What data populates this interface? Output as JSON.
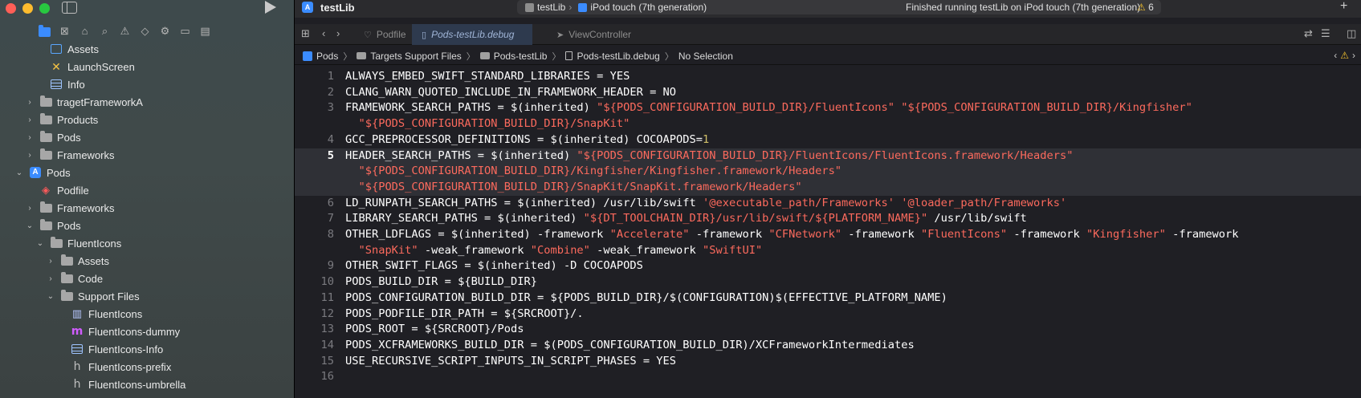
{
  "sidebar": {
    "tree": [
      {
        "label": "Assets",
        "indent": 2,
        "icon": "assets",
        "disclosure": ""
      },
      {
        "label": "LaunchScreen",
        "indent": 2,
        "icon": "launch",
        "disclosure": ""
      },
      {
        "label": "Info",
        "indent": 2,
        "icon": "table",
        "disclosure": ""
      },
      {
        "label": "tragetFrameworkA",
        "indent": 1,
        "icon": "folder",
        "disclosure": "›"
      },
      {
        "label": "Products",
        "indent": 1,
        "icon": "folder",
        "disclosure": "›"
      },
      {
        "label": "Pods",
        "indent": 1,
        "icon": "folder",
        "disclosure": "›"
      },
      {
        "label": "Frameworks",
        "indent": 1,
        "icon": "folder",
        "disclosure": "›"
      },
      {
        "label": "Pods",
        "indent": 0,
        "icon": "project",
        "disclosure": "⌄"
      },
      {
        "label": "Podfile",
        "indent": 1,
        "icon": "podfile",
        "disclosure": ""
      },
      {
        "label": "Frameworks",
        "indent": 1,
        "icon": "folder",
        "disclosure": "›"
      },
      {
        "label": "Pods",
        "indent": 1,
        "icon": "folder",
        "disclosure": "⌄"
      },
      {
        "label": "FluentIcons",
        "indent": 2,
        "icon": "folder",
        "disclosure": "⌄"
      },
      {
        "label": "Assets",
        "indent": 3,
        "icon": "folder",
        "disclosure": "›"
      },
      {
        "label": "Code",
        "indent": 3,
        "icon": "folder",
        "disclosure": "›"
      },
      {
        "label": "Support Files",
        "indent": 3,
        "icon": "folder",
        "disclosure": "⌄"
      },
      {
        "label": "FluentIcons",
        "indent": 4,
        "icon": "map",
        "disclosure": ""
      },
      {
        "label": "FluentIcons-dummy",
        "indent": 4,
        "icon": "m",
        "disclosure": ""
      },
      {
        "label": "FluentIcons-Info",
        "indent": 4,
        "icon": "table",
        "disclosure": ""
      },
      {
        "label": "FluentIcons-prefix",
        "indent": 4,
        "icon": "h",
        "disclosure": ""
      },
      {
        "label": "FluentIcons-umbrella",
        "indent": 4,
        "icon": "h",
        "disclosure": ""
      }
    ]
  },
  "window": {
    "title": "testLib",
    "scheme": "testLib",
    "device": "iPod touch (7th generation)",
    "status": "Finished running testLib on iPod touch (7th generation)",
    "warning_count": "6"
  },
  "tabs": [
    {
      "label": "Podfile",
      "active": false
    },
    {
      "label": "Pods-testLib.debug",
      "active": true
    },
    {
      "label": "ViewController",
      "active": false
    }
  ],
  "breadcrumb": [
    "Pods",
    "Targets Support Files",
    "Pods-testLib",
    "Pods-testLib.debug",
    "No Selection"
  ],
  "code": {
    "highlighted_line": 5,
    "lines": [
      {
        "n": "1",
        "rows": [
          [
            [
              "p",
              "ALWAYS_EMBED_SWIFT_STANDARD_LIBRARIES = YES"
            ]
          ]
        ]
      },
      {
        "n": "2",
        "rows": [
          [
            [
              "p",
              "CLANG_WARN_QUOTED_INCLUDE_IN_FRAMEWORK_HEADER = NO"
            ]
          ]
        ]
      },
      {
        "n": "3",
        "rows": [
          [
            [
              "p",
              "FRAMEWORK_SEARCH_PATHS = $(inherited) "
            ],
            [
              "s",
              "\"${PODS_CONFIGURATION_BUILD_DIR}/FluentIcons\""
            ],
            [
              "p",
              " "
            ],
            [
              "s",
              "\"${PODS_CONFIGURATION_BUILD_DIR}/Kingfisher\""
            ]
          ],
          [
            [
              "p",
              "  "
            ],
            [
              "s",
              "\"${PODS_CONFIGURATION_BUILD_DIR}/SnapKit\""
            ]
          ]
        ]
      },
      {
        "n": "4",
        "rows": [
          [
            [
              "p",
              "GCC_PREPROCESSOR_DEFINITIONS = $(inherited) COCOAPODS="
            ],
            [
              "n",
              "1"
            ]
          ]
        ]
      },
      {
        "n": "5",
        "rows": [
          [
            [
              "p",
              "HEADER_SEARCH_PATHS = $(inherited) "
            ],
            [
              "s",
              "\"${PODS_CONFIGURATION_BUILD_DIR}/FluentIcons/FluentIcons.framework/Headers\""
            ]
          ],
          [
            [
              "p",
              "  "
            ],
            [
              "s",
              "\"${PODS_CONFIGURATION_BUILD_DIR}/Kingfisher/Kingfisher.framework/Headers\""
            ]
          ],
          [
            [
              "p",
              "  "
            ],
            [
              "s",
              "\"${PODS_CONFIGURATION_BUILD_DIR}/SnapKit/SnapKit.framework/Headers\""
            ]
          ]
        ]
      },
      {
        "n": "6",
        "rows": [
          [
            [
              "p",
              "LD_RUNPATH_SEARCH_PATHS = $(inherited) /usr/lib/swift "
            ],
            [
              "s",
              "'@executable_path/Frameworks'"
            ],
            [
              "p",
              " "
            ],
            [
              "s",
              "'@loader_path/Frameworks'"
            ]
          ]
        ]
      },
      {
        "n": "7",
        "rows": [
          [
            [
              "p",
              "LIBRARY_SEARCH_PATHS = $(inherited) "
            ],
            [
              "s",
              "\"${DT_TOOLCHAIN_DIR}/usr/lib/swift/${PLATFORM_NAME}\""
            ],
            [
              "p",
              " /usr/lib/swift"
            ]
          ]
        ]
      },
      {
        "n": "8",
        "rows": [
          [
            [
              "p",
              "OTHER_LDFLAGS = $(inherited) -framework "
            ],
            [
              "s",
              "\"Accelerate\""
            ],
            [
              "p",
              " -framework "
            ],
            [
              "s",
              "\"CFNetwork\""
            ],
            [
              "p",
              " -framework "
            ],
            [
              "s",
              "\"FluentIcons\""
            ],
            [
              "p",
              " -framework "
            ],
            [
              "s",
              "\"Kingfisher\""
            ],
            [
              "p",
              " -framework"
            ]
          ],
          [
            [
              "p",
              "  "
            ],
            [
              "s",
              "\"SnapKit\""
            ],
            [
              "p",
              " -weak_framework "
            ],
            [
              "s",
              "\"Combine\""
            ],
            [
              "p",
              " -weak_framework "
            ],
            [
              "s",
              "\"SwiftUI\""
            ]
          ]
        ]
      },
      {
        "n": "9",
        "rows": [
          [
            [
              "p",
              "OTHER_SWIFT_FLAGS = $(inherited) -D COCOAPODS"
            ]
          ]
        ]
      },
      {
        "n": "10",
        "rows": [
          [
            [
              "p",
              "PODS_BUILD_DIR = ${BUILD_DIR}"
            ]
          ]
        ]
      },
      {
        "n": "11",
        "rows": [
          [
            [
              "p",
              "PODS_CONFIGURATION_BUILD_DIR = ${PODS_BUILD_DIR}/$(CONFIGURATION)$(EFFECTIVE_PLATFORM_NAME)"
            ]
          ]
        ]
      },
      {
        "n": "12",
        "rows": [
          [
            [
              "p",
              "PODS_PODFILE_DIR_PATH = ${SRCROOT}/."
            ]
          ]
        ]
      },
      {
        "n": "13",
        "rows": [
          [
            [
              "p",
              "PODS_ROOT = ${SRCROOT}/Pods"
            ]
          ]
        ]
      },
      {
        "n": "14",
        "rows": [
          [
            [
              "p",
              "PODS_XCFRAMEWORKS_BUILD_DIR = $(PODS_CONFIGURATION_BUILD_DIR)/XCFrameworkIntermediates"
            ]
          ]
        ]
      },
      {
        "n": "15",
        "rows": [
          [
            [
              "p",
              "USE_RECURSIVE_SCRIPT_INPUTS_IN_SCRIPT_PHASES = YES"
            ]
          ]
        ]
      },
      {
        "n": "16",
        "rows": [
          [
            [
              "p",
              ""
            ]
          ]
        ]
      }
    ]
  },
  "colors": {
    "string": "#fc6a5d",
    "number": "#d0bf69",
    "plain": "#ffffff",
    "accent": "#3b8cff",
    "warning": "#f2c12e"
  }
}
